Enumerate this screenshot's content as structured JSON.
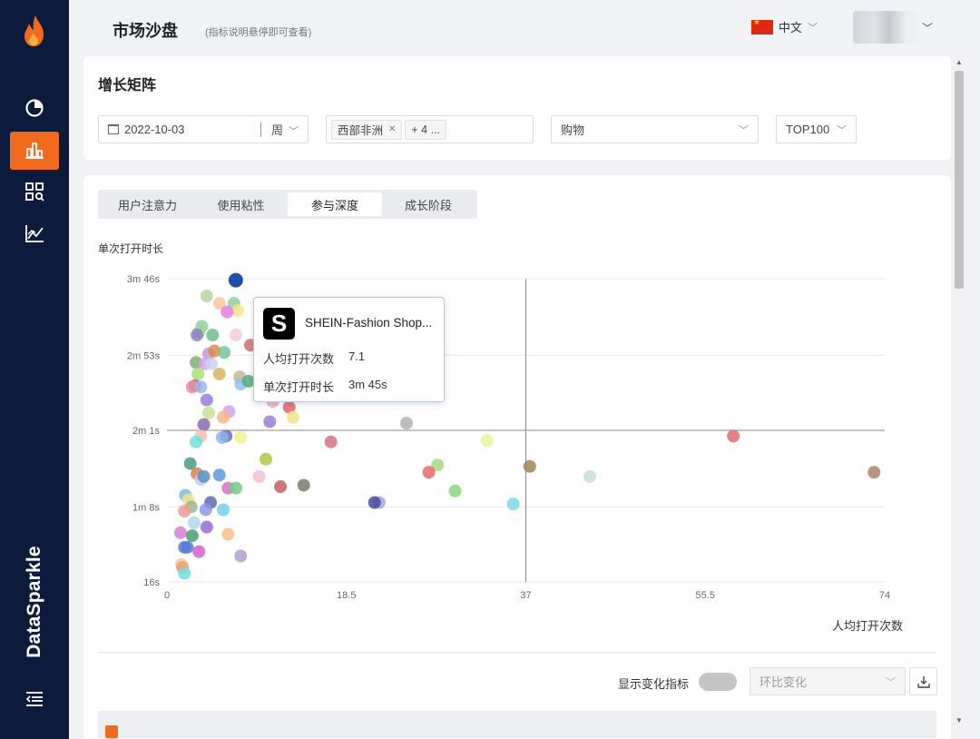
{
  "sidebar": {
    "brand": "DataSparkle",
    "nav": [
      {
        "icon": "pie-chart-icon",
        "active": false
      },
      {
        "icon": "bar-chart-icon",
        "active": true
      },
      {
        "icon": "grid-search-icon",
        "active": false
      },
      {
        "icon": "line-chart-icon",
        "active": false
      }
    ]
  },
  "header": {
    "title": "市场沙盘",
    "hint": "(指标说明悬停即可查看)",
    "language": "中文"
  },
  "filters": {
    "section_title": "增长矩阵",
    "date": "2022-10-03",
    "period": "周",
    "region_tag": "西部非洲",
    "region_more": "+ 4 ...",
    "category": "购物",
    "rank": "TOP100"
  },
  "tabs": [
    "用户注意力",
    "使用粘性",
    "参与深度",
    "成长阶段"
  ],
  "active_tab": 2,
  "tooltip": {
    "app_name": "SHEIN-Fashion Shop...",
    "logo_letter": "S",
    "metric1_label": "人均打开次数",
    "metric1_value": "7.1",
    "metric2_label": "单次打开时长",
    "metric2_value": "3m 45s"
  },
  "controls": {
    "toggle_label": "显示变化指标",
    "change_select": "环比变化"
  },
  "chart_data": {
    "type": "scatter",
    "xlabel": "人均打开次数",
    "ylabel": "单次打开时长",
    "xlim": [
      0,
      74
    ],
    "ylim": [
      16,
      226
    ],
    "x_ticks": [
      {
        "v": 0,
        "label": "0"
      },
      {
        "v": 18.5,
        "label": "18.5"
      },
      {
        "v": 37,
        "label": "37"
      },
      {
        "v": 55.5,
        "label": "55.5"
      },
      {
        "v": 74,
        "label": "74"
      }
    ],
    "y_ticks": [
      {
        "v": 16,
        "label": "16s"
      },
      {
        "v": 68,
        "label": "1m 8s"
      },
      {
        "v": 121,
        "label": "2m 1s"
      },
      {
        "v": 173,
        "label": "2m 53s"
      },
      {
        "v": 226,
        "label": "3m 46s"
      }
    ],
    "reference": {
      "x": 37,
      "y": 121
    },
    "highlight": {
      "x": 7.1,
      "y": 225,
      "color": "#1f4fa8"
    },
    "points": [
      [
        4.1,
        214,
        "#b5d6a0"
      ],
      [
        5.4,
        209,
        "#f9c79a"
      ],
      [
        6.9,
        209,
        "#8fd19e"
      ],
      [
        7.3,
        204,
        "#f4e38a"
      ],
      [
        6.2,
        203,
        "#e87ee0"
      ],
      [
        3.6,
        193,
        "#8fd19e"
      ],
      [
        3.3,
        189,
        "#a6d985"
      ],
      [
        3.1,
        187,
        "#8a7fc9"
      ],
      [
        4.7,
        187,
        "#6dbf8a"
      ],
      [
        7.1,
        187,
        "#f2d0d8"
      ],
      [
        8.6,
        180,
        "#c8746e"
      ],
      [
        4.3,
        174,
        "#c19bd6"
      ],
      [
        4.9,
        176,
        "#e08a4a"
      ],
      [
        5.9,
        175,
        "#77c49a"
      ],
      [
        3,
        168,
        "#80b070"
      ],
      [
        3.9,
        167,
        "#d6a0e8"
      ],
      [
        4.6,
        167,
        "#c8d4f0"
      ],
      [
        3.2,
        160,
        "#a8e070"
      ],
      [
        5.4,
        160,
        "#d9b45c"
      ],
      [
        2.9,
        152,
        "#a06e74"
      ],
      [
        2.6,
        151,
        "#f08ca0"
      ],
      [
        3.5,
        151,
        "#a0b4f0"
      ],
      [
        7.5,
        158,
        "#c4b58c"
      ],
      [
        7.6,
        153,
        "#90c0f0"
      ],
      [
        8.4,
        155,
        "#54aa7c"
      ],
      [
        4.1,
        142,
        "#9a7ce0"
      ],
      [
        10.9,
        141,
        "#f2aeb8"
      ],
      [
        4.3,
        133,
        "#c8e090"
      ],
      [
        6.4,
        134,
        "#d6a0e8"
      ],
      [
        5.8,
        130,
        "#f7b58a"
      ],
      [
        12.6,
        137,
        "#e0666e"
      ],
      [
        13,
        130,
        "#f2e48c"
      ],
      [
        10.6,
        127,
        "#9a7cd0"
      ],
      [
        3.8,
        125,
        "#8a6ab0"
      ],
      [
        6.1,
        117,
        "#7a6ab0"
      ],
      [
        5.7,
        116,
        "#8ab4f0"
      ],
      [
        7.6,
        116,
        "#f2f08c"
      ],
      [
        3.5,
        117,
        "#f4c0b0"
      ],
      [
        3,
        113,
        "#70e0e0"
      ],
      [
        16.9,
        113,
        "#d66e86"
      ],
      [
        24.7,
        126,
        "#b0b0b0"
      ],
      [
        33,
        114,
        "#e8f09a"
      ],
      [
        58.4,
        117,
        "#e06b6b"
      ],
      [
        10.2,
        101,
        "#b0c840"
      ],
      [
        2.4,
        98,
        "#4a9a8a"
      ],
      [
        27.9,
        97,
        "#a6d985"
      ],
      [
        37.4,
        96,
        "#9b8556"
      ],
      [
        3.1,
        91,
        "#d88050"
      ],
      [
        3.5,
        87,
        "#bcd0f0"
      ],
      [
        3.8,
        89,
        "#5a90c0"
      ],
      [
        5.4,
        90,
        "#5a9ad8"
      ],
      [
        9.5,
        89,
        "#f2c0d4"
      ],
      [
        6.3,
        81,
        "#d672c0"
      ],
      [
        7.1,
        81,
        "#6fcf80"
      ],
      [
        11.7,
        82,
        "#c4605c"
      ],
      [
        14.1,
        83,
        "#7a7a6a"
      ],
      [
        27,
        92,
        "#e06b6b"
      ],
      [
        29.7,
        79,
        "#8ad87a"
      ],
      [
        43.6,
        89,
        "#c8dcd8"
      ],
      [
        72.9,
        92,
        "#b0826c"
      ],
      [
        1.9,
        76,
        "#7ab8f0"
      ],
      [
        2.2,
        73,
        "#f2e48c"
      ],
      [
        4.5,
        71,
        "#5a6ab0"
      ],
      [
        2.5,
        68,
        "#9ab890"
      ],
      [
        1.8,
        65,
        "#f29a9a"
      ],
      [
        4,
        66,
        "#8a9ae0"
      ],
      [
        5.8,
        66,
        "#70d0f0"
      ],
      [
        21.9,
        71,
        "#a8a8e8"
      ],
      [
        21.4,
        71,
        "#4a4a98"
      ],
      [
        35.7,
        70,
        "#7ad8f0"
      ],
      [
        2.8,
        57,
        "#b0d8f0"
      ],
      [
        4.1,
        54,
        "#9a6ad8"
      ],
      [
        1.4,
        50,
        "#d680d8"
      ],
      [
        2.6,
        48,
        "#4aa070"
      ],
      [
        6.3,
        49,
        "#f7c08a"
      ],
      [
        1.8,
        40,
        "#5a7ad8"
      ],
      [
        2.1,
        40,
        "#5a7ad8"
      ],
      [
        3.3,
        37,
        "#d060d8"
      ],
      [
        7.6,
        34,
        "#b0a0d0"
      ],
      [
        1.5,
        28,
        "#f2c8a0"
      ],
      [
        1.6,
        26,
        "#f2a070"
      ],
      [
        1.8,
        22,
        "#70e0e0"
      ]
    ]
  }
}
